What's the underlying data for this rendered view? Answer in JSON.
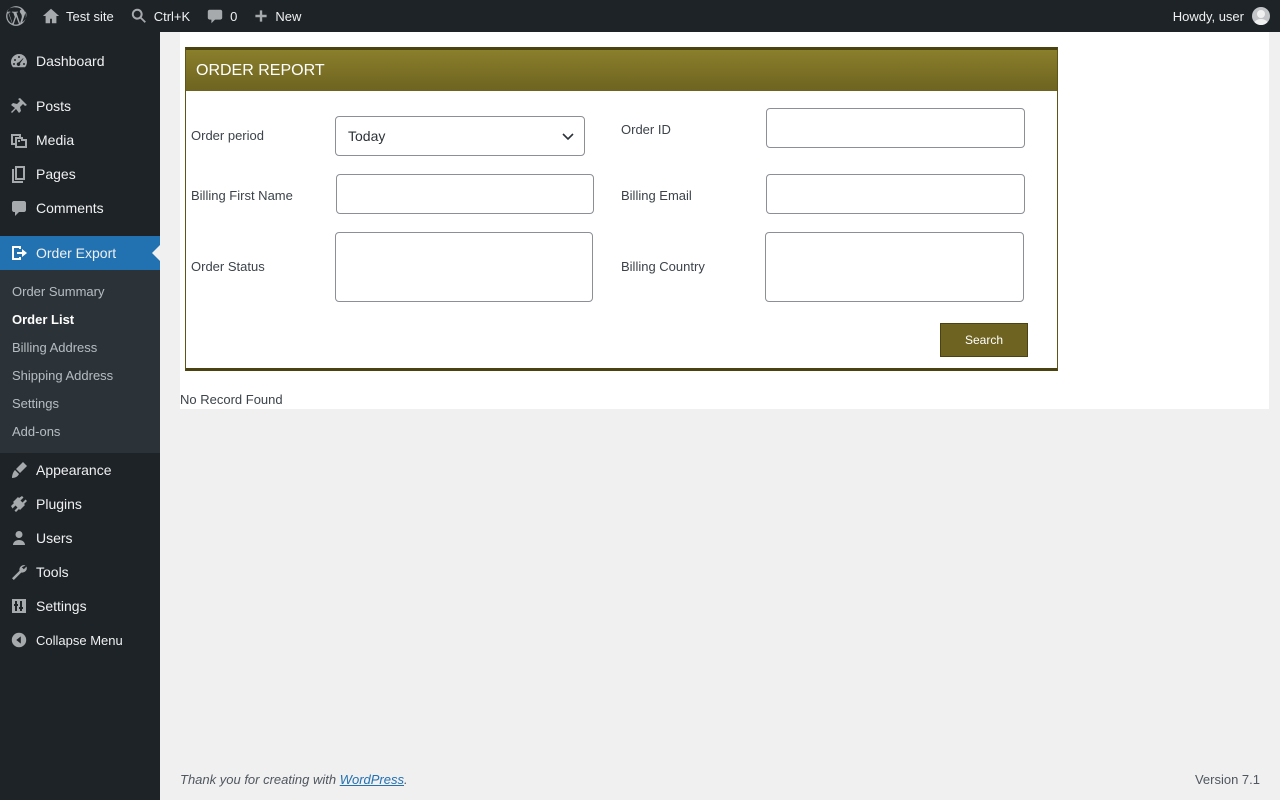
{
  "adminbar": {
    "site_name": "Test site",
    "search_shortcut": "Ctrl+K",
    "comments_count": "0",
    "new_label": "New",
    "howdy": "Howdy, user"
  },
  "menu": {
    "dashboard": "Dashboard",
    "posts": "Posts",
    "media": "Media",
    "pages": "Pages",
    "comments": "Comments",
    "order_export": "Order Export",
    "submenu": [
      "Order Summary",
      "Order List",
      "Billing Address",
      "Shipping Address",
      "Settings",
      "Add-ons"
    ],
    "appearance": "Appearance",
    "plugins": "Plugins",
    "users": "Users",
    "tools": "Tools",
    "settings": "Settings",
    "collapse": "Collapse Menu"
  },
  "report": {
    "title": "ORDER REPORT",
    "order_period_label": "Order period",
    "order_period_value": "Today",
    "order_id_label": "Order ID",
    "order_id_value": "",
    "billing_first_name_label": "Billing First Name",
    "billing_first_name_value": "",
    "billing_email_label": "Billing Email",
    "billing_email_value": "",
    "order_status_label": "Order Status",
    "billing_country_label": "Billing Country",
    "search_button": "Search",
    "no_record": "No Record Found"
  },
  "footer": {
    "thanks_prefix": "Thank you for creating with ",
    "wordpress_link": "WordPress",
    "thanks_suffix": ".",
    "version": "Version 7.1"
  }
}
